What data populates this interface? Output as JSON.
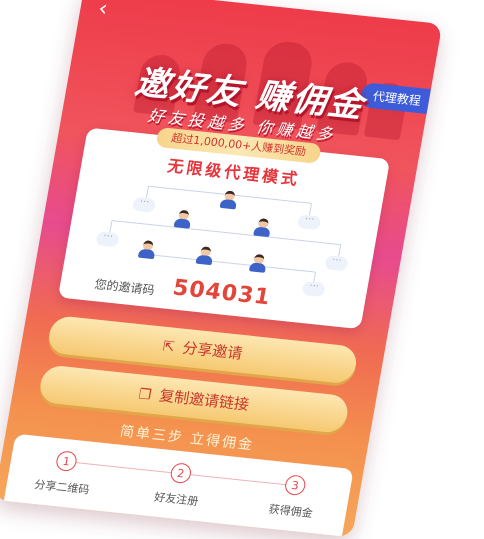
{
  "nav": {
    "back_glyph": "‹",
    "tutorial_label": "代理教程"
  },
  "hero": {
    "title": "邀好友  赚佣金",
    "subtitle": "好友投越多 你赚越多"
  },
  "card": {
    "ribbon": "超过1,000,00+人赚到奖励",
    "mode_title": "无限级代理模式",
    "invite_label": "您的邀请码",
    "invite_code": "504031"
  },
  "actions": {
    "share_label": "分享邀请",
    "share_icon": "share-icon",
    "copy_label": "复制邀请链接",
    "copy_icon": "copy-icon"
  },
  "steps": {
    "title": "简单三步 立得佣金",
    "items": [
      {
        "num": "1",
        "label": "分享二维码"
      },
      {
        "num": "2",
        "label": "好友注册"
      },
      {
        "num": "3",
        "label": "获得佣金"
      }
    ]
  },
  "colors": {
    "accent": "#e8343b",
    "button_gold": "#f6c972",
    "tutorial_blue": "#3e5bd9"
  }
}
